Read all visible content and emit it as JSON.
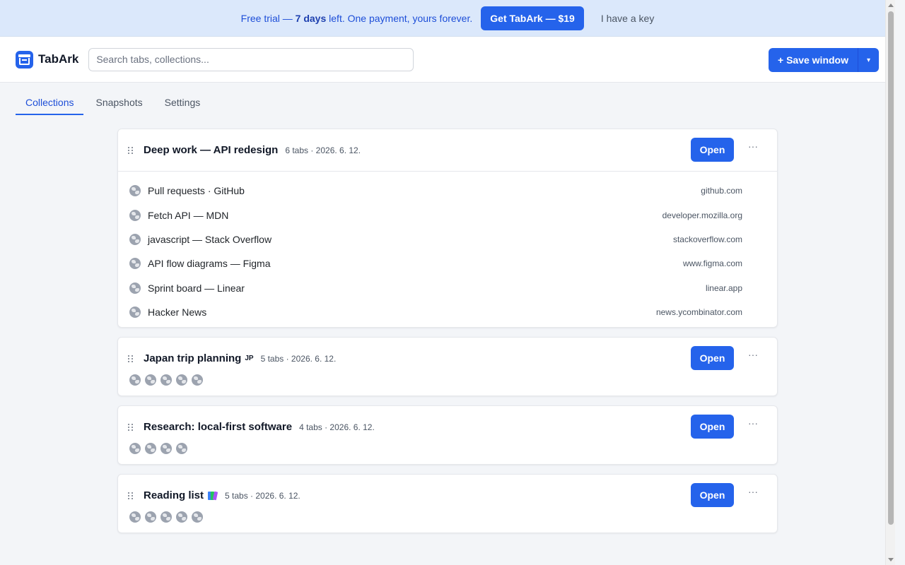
{
  "banner": {
    "text_pre": "Free trial — ",
    "days": "7 days",
    "text_post": " left. One payment, yours forever.",
    "buy_label": "Get TabArk — $19",
    "key_label": "I have a key"
  },
  "header": {
    "app_name": "TabArk",
    "search_placeholder": "Search tabs, collections...",
    "save_label": "+ Save window",
    "save_menu_icon": "▾"
  },
  "tabs": [
    {
      "label": "Collections",
      "active": true
    },
    {
      "label": "Snapshots",
      "active": false
    },
    {
      "label": "Settings",
      "active": false
    }
  ],
  "collections": [
    {
      "title": "Deep work — API redesign",
      "meta": "6 tabs · 2026. 6. 12.",
      "open_label": "Open",
      "more_label": "···",
      "expanded": true,
      "tabs": [
        {
          "title": "Pull requests · GitHub",
          "host": "github.com"
        },
        {
          "title": "Fetch API — MDN",
          "host": "developer.mozilla.org"
        },
        {
          "title": "javascript — Stack Overflow",
          "host": "stackoverflow.com"
        },
        {
          "title": "API flow diagrams — Figma",
          "host": "www.figma.com"
        },
        {
          "title": "Sprint board — Linear",
          "host": "linear.app"
        },
        {
          "title": "Hacker News",
          "host": "news.ycombinator.com"
        }
      ]
    },
    {
      "title": "Japan trip planning",
      "emoji": "JP",
      "meta": "5 tabs · 2026. 6. 12.",
      "open_label": "Open",
      "more_label": "···",
      "expanded": false,
      "favicon_count": 5
    },
    {
      "title": "Research: local-first software",
      "meta": "4 tabs · 2026. 6. 12.",
      "open_label": "Open",
      "more_label": "···",
      "expanded": false,
      "favicon_count": 4
    },
    {
      "title": "Reading list",
      "emoji_icon": "books-icon",
      "meta": "5 tabs · 2026. 6. 12.",
      "open_label": "Open",
      "more_label": "···",
      "expanded": false,
      "favicon_count": 5
    }
  ],
  "colors": {
    "accent": "#2563eb",
    "banner_bg": "#dbe8fb",
    "page_bg": "#f3f5f8"
  }
}
